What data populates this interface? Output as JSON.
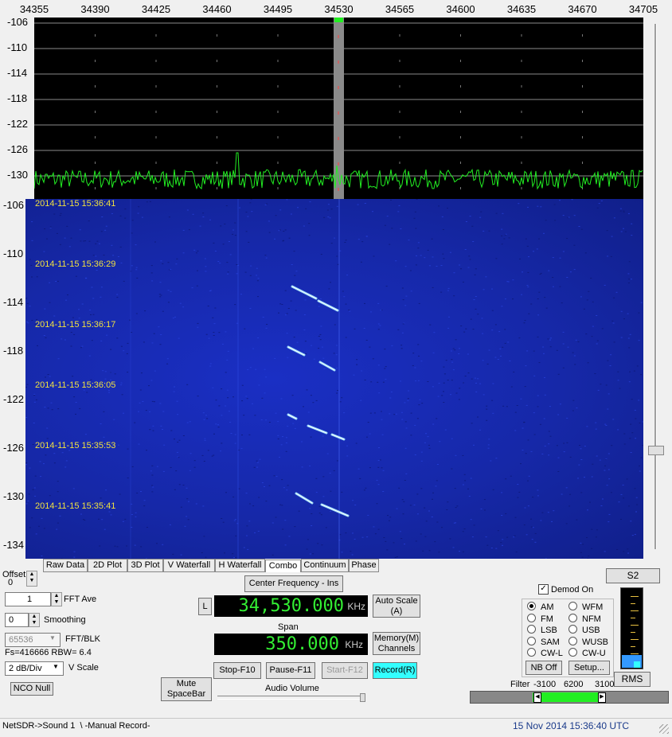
{
  "freq_axis": [
    "34355",
    "34390",
    "34425",
    "34460",
    "34495",
    "34530",
    "34565",
    "34600",
    "34635",
    "34670",
    "34705"
  ],
  "spectrum_db_axis": [
    "-106",
    "-110",
    "-114",
    "-118",
    "-122",
    "-126",
    "-130"
  ],
  "waterfall_db_axis": [
    "-106",
    "-110",
    "-114",
    "-118",
    "-122",
    "-126",
    "-130",
    "-134"
  ],
  "timestamps": [
    "2014-11-15 15:36:41",
    "2014-11-15 15:36:29",
    "2014-11-15 15:36:17",
    "2014-11-15 15:36:05",
    "2014-11-15 15:35:53",
    "2014-11-15 15:35:41"
  ],
  "tabs": [
    "Raw Data",
    "2D Plot",
    "3D Plot",
    "V Waterfall",
    "H Waterfall",
    "Combo",
    "Continuum",
    "Phase"
  ],
  "active_tab": "Combo",
  "controls": {
    "offset_label": "Offset",
    "offset_value": "0",
    "fft_ave_value": "1",
    "fft_ave_label": "FFT Ave",
    "smoothing_value": "0",
    "smoothing_label": "Smoothing",
    "fft_blk_value": "65536",
    "fft_blk_label": "FFT/BLK",
    "fs_info": "Fs=416666 RBW= 6.4",
    "vscale_value": "2 dB/Div",
    "vscale_label": "V Scale",
    "nco_null": "NCO Null",
    "mute": "Mute\nSpaceBar",
    "audio_volume": "Audio Volume"
  },
  "center": {
    "button": "Center Frequency - Ins",
    "l_button": "L",
    "freq": "34,530.000",
    "freq_unit": "KHz",
    "auto_scale": "Auto Scale\n(A)",
    "span_label": "Span",
    "span": "350.000",
    "span_unit": "KHz",
    "memory": "Memory(M)\nChannels",
    "stop": "Stop-F10",
    "pause": "Pause-F11",
    "start": "Start-F12",
    "record": "Record(R)"
  },
  "demod": {
    "s_meter": "S2",
    "demod_on": "Demod On",
    "modes_left": [
      "AM",
      "FM",
      "LSB",
      "SAM",
      "CW-L"
    ],
    "modes_right": [
      "WFM",
      "NFM",
      "USB",
      "WUSB",
      "CW-U"
    ],
    "selected": "AM",
    "nb_off": "NB Off",
    "setup": "Setup...",
    "rms": "RMS",
    "filter_label": "Filter",
    "filter_low": "-3100",
    "filter_width": "6200",
    "filter_high": "3100"
  },
  "status": {
    "left": "NetSDR->Sound 1  \\ -Manual Record-",
    "right": "15 Nov 2014  15:36:40 UTC"
  },
  "colors": {
    "trace": "#22ee22",
    "record_active": "#33ffff",
    "lcd_text": "#33ee33"
  }
}
